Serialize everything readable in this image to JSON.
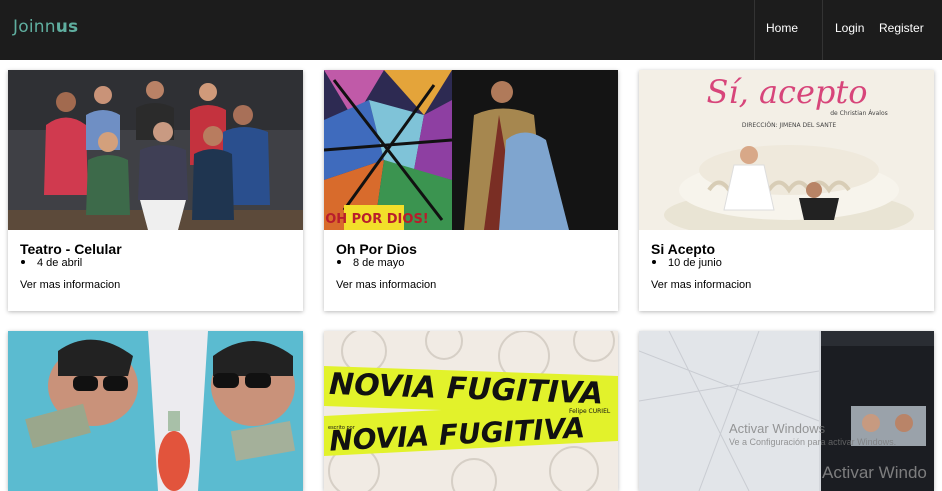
{
  "brand": {
    "part1": "Joinn",
    "part2": "us"
  },
  "nav": {
    "home": "Home",
    "login": "Login",
    "register": "Register"
  },
  "cards": [
    {
      "title": "Teatro - Celular",
      "date": "4 de abril",
      "link": "Ver mas informacion"
    },
    {
      "title": "Oh Por Dios",
      "date": "8 de mayo",
      "link": "Ver mas informacion",
      "poster_text": "¡OH POR DIOS!"
    },
    {
      "title": "Si Acepto",
      "date": "10 de junio",
      "link": "Ver mas informacion",
      "poster": {
        "title": "Sí, acepto",
        "author": "de Christian Ávalos",
        "direction": "DIRECCIÓN: JIMENA DEL SANTE"
      }
    },
    {
      "title": "",
      "date": "",
      "link": ""
    },
    {
      "title": "",
      "date": "",
      "link": "",
      "poster": {
        "line1": "NOVIA FUGITIVA",
        "line2": "NOVIA FUGITIVA",
        "credit": "Felipe CURIEL",
        "written": "escrito por"
      }
    },
    {
      "title": "",
      "date": "",
      "link": ""
    }
  ],
  "watermark": {
    "line1": "Activar Windows",
    "line2": "Ve a Configuración para activar Windows.",
    "line3": "Activar Windo"
  },
  "colors": {
    "navbar": "#1c1c1c",
    "brand": "#5fae9f",
    "poster_yellow": "#e2f22b"
  }
}
